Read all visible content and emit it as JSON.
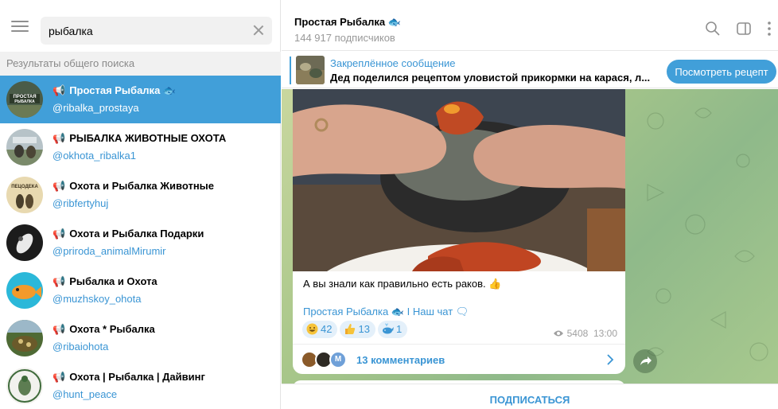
{
  "search": {
    "value": "рыбалка",
    "placeholder": ""
  },
  "results_header": "Результаты общего поиска",
  "results": [
    {
      "title": "Простая Рыбалка",
      "handle": "@ribalka_prostaya",
      "active": true,
      "avatar_text": "ПРОСТАЯ РЫБАЛКА"
    },
    {
      "title": "РЫБАЛКА ЖИВОТНЫЕ ОХОТА",
      "handle": "@okhota_ribalka1",
      "active": false
    },
    {
      "title": "Охота и Рыбалка Животные",
      "handle": "@ribfertyhuj",
      "active": false,
      "avatar_text": "ПЕЦОДЕКА"
    },
    {
      "title": "Охота и Рыбалка Подарки",
      "handle": "@priroda_animalMirumir",
      "active": false
    },
    {
      "title": "Рыбалка и Охота",
      "handle": "@muzhskoy_ohota",
      "active": false
    },
    {
      "title": "Охота * Рыбалка",
      "handle": "@ribaiohota",
      "active": false
    },
    {
      "title": "Охота | Рыбалка | Дайвинг",
      "handle": "@hunt_peace",
      "active": false
    }
  ],
  "chat": {
    "title": "Простая Рыбалка",
    "subscribers": "144 917 подписчиков"
  },
  "pinned": {
    "label": "Закреплённое сообщение",
    "text": "Дед поделился рецептом уловистой прикормки на карася, л...",
    "button": "Посмотреть рецепт"
  },
  "post": {
    "caption": "А вы знали как правильно есть раков.",
    "link_channel": "Простая Рыбалка",
    "link_separator": " I ",
    "link_chat": "Наш чат",
    "reactions": [
      {
        "emoji": "grin",
        "count": "42"
      },
      {
        "emoji": "thumbs-up",
        "count": "13"
      },
      {
        "emoji": "whale",
        "count": "1"
      }
    ],
    "views": "5408",
    "time": "13:00",
    "comments": "13 комментариев",
    "comment_avatar_letter": "M"
  },
  "subscribe": "ПОДПИСАТЬСЯ",
  "colors": {
    "accent": "#419fd9",
    "link": "#3a95d4",
    "reaction_bg": "#e4f0fa",
    "chat_bg": "#a9c78a"
  }
}
